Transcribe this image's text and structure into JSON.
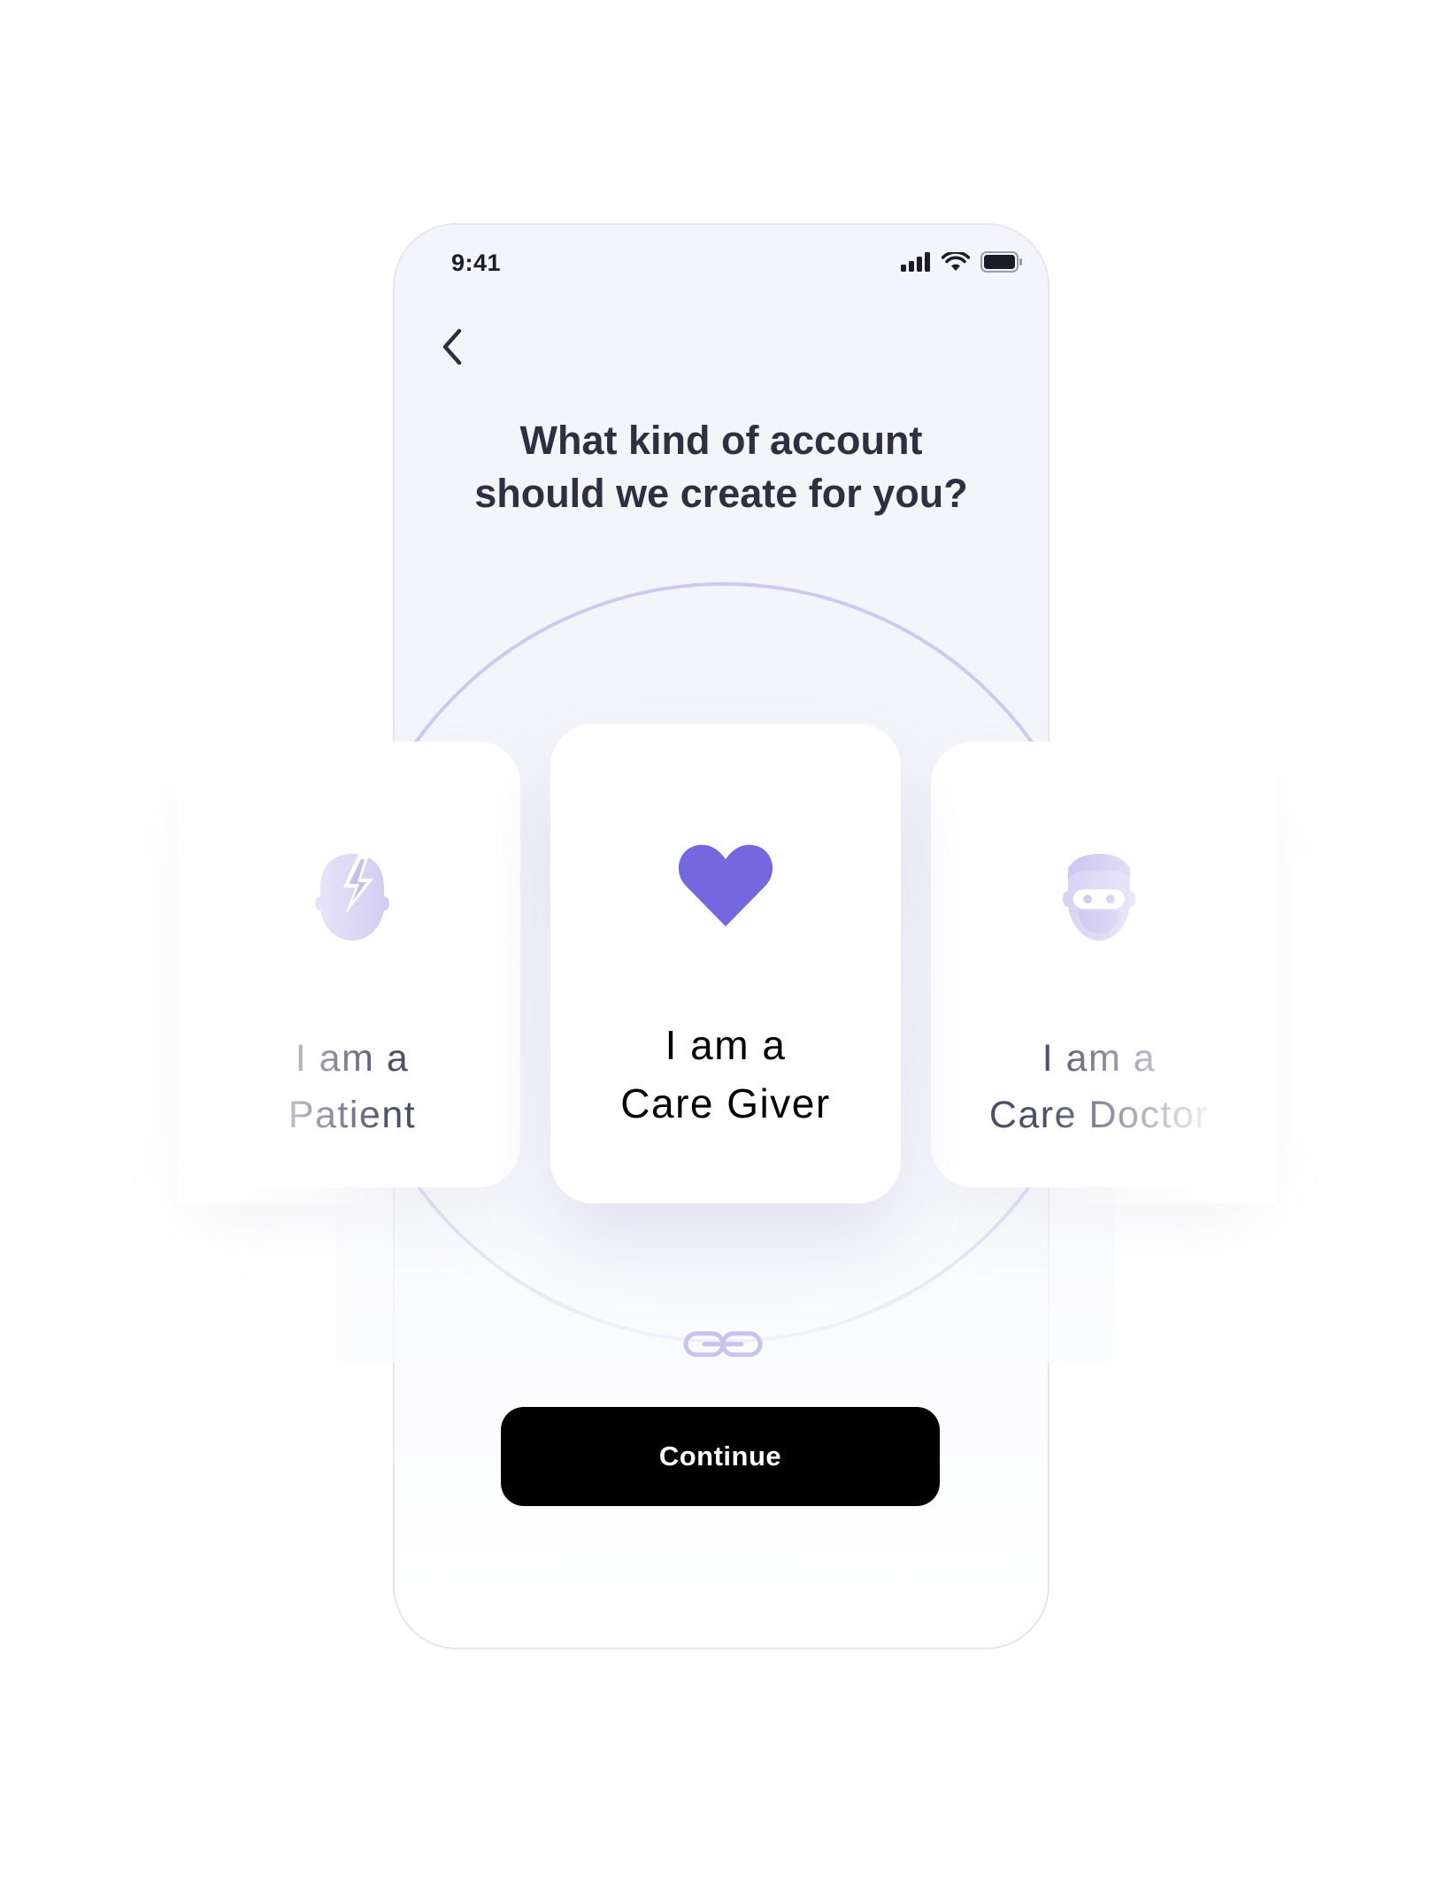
{
  "status_bar": {
    "time": "9:41",
    "icons": [
      "cellular-signal-icon",
      "wifi-icon",
      "battery-icon"
    ]
  },
  "nav": {
    "back_icon": "chevron-left-icon"
  },
  "question": "What kind of account\nshould we create for you?",
  "account_types": [
    {
      "line1": "I am a",
      "line2": "Patient",
      "icon": "head-lightning-icon",
      "selected": false
    },
    {
      "line1": "I am a",
      "line2": "Care Giver",
      "icon": "heart-icon",
      "selected": true
    },
    {
      "line1": "I am a",
      "line2": "Care Doctor",
      "icon": "doctor-mask-icon",
      "selected": false
    }
  ],
  "pager_icon": "chain-link-icon",
  "continue_label": "Continue",
  "colors": {
    "accent": "#7467e0",
    "accent_light": "#d3ccf2",
    "ring": "#cfc8ef",
    "button_bg": "#000000",
    "title_text": "#2e2f40"
  }
}
